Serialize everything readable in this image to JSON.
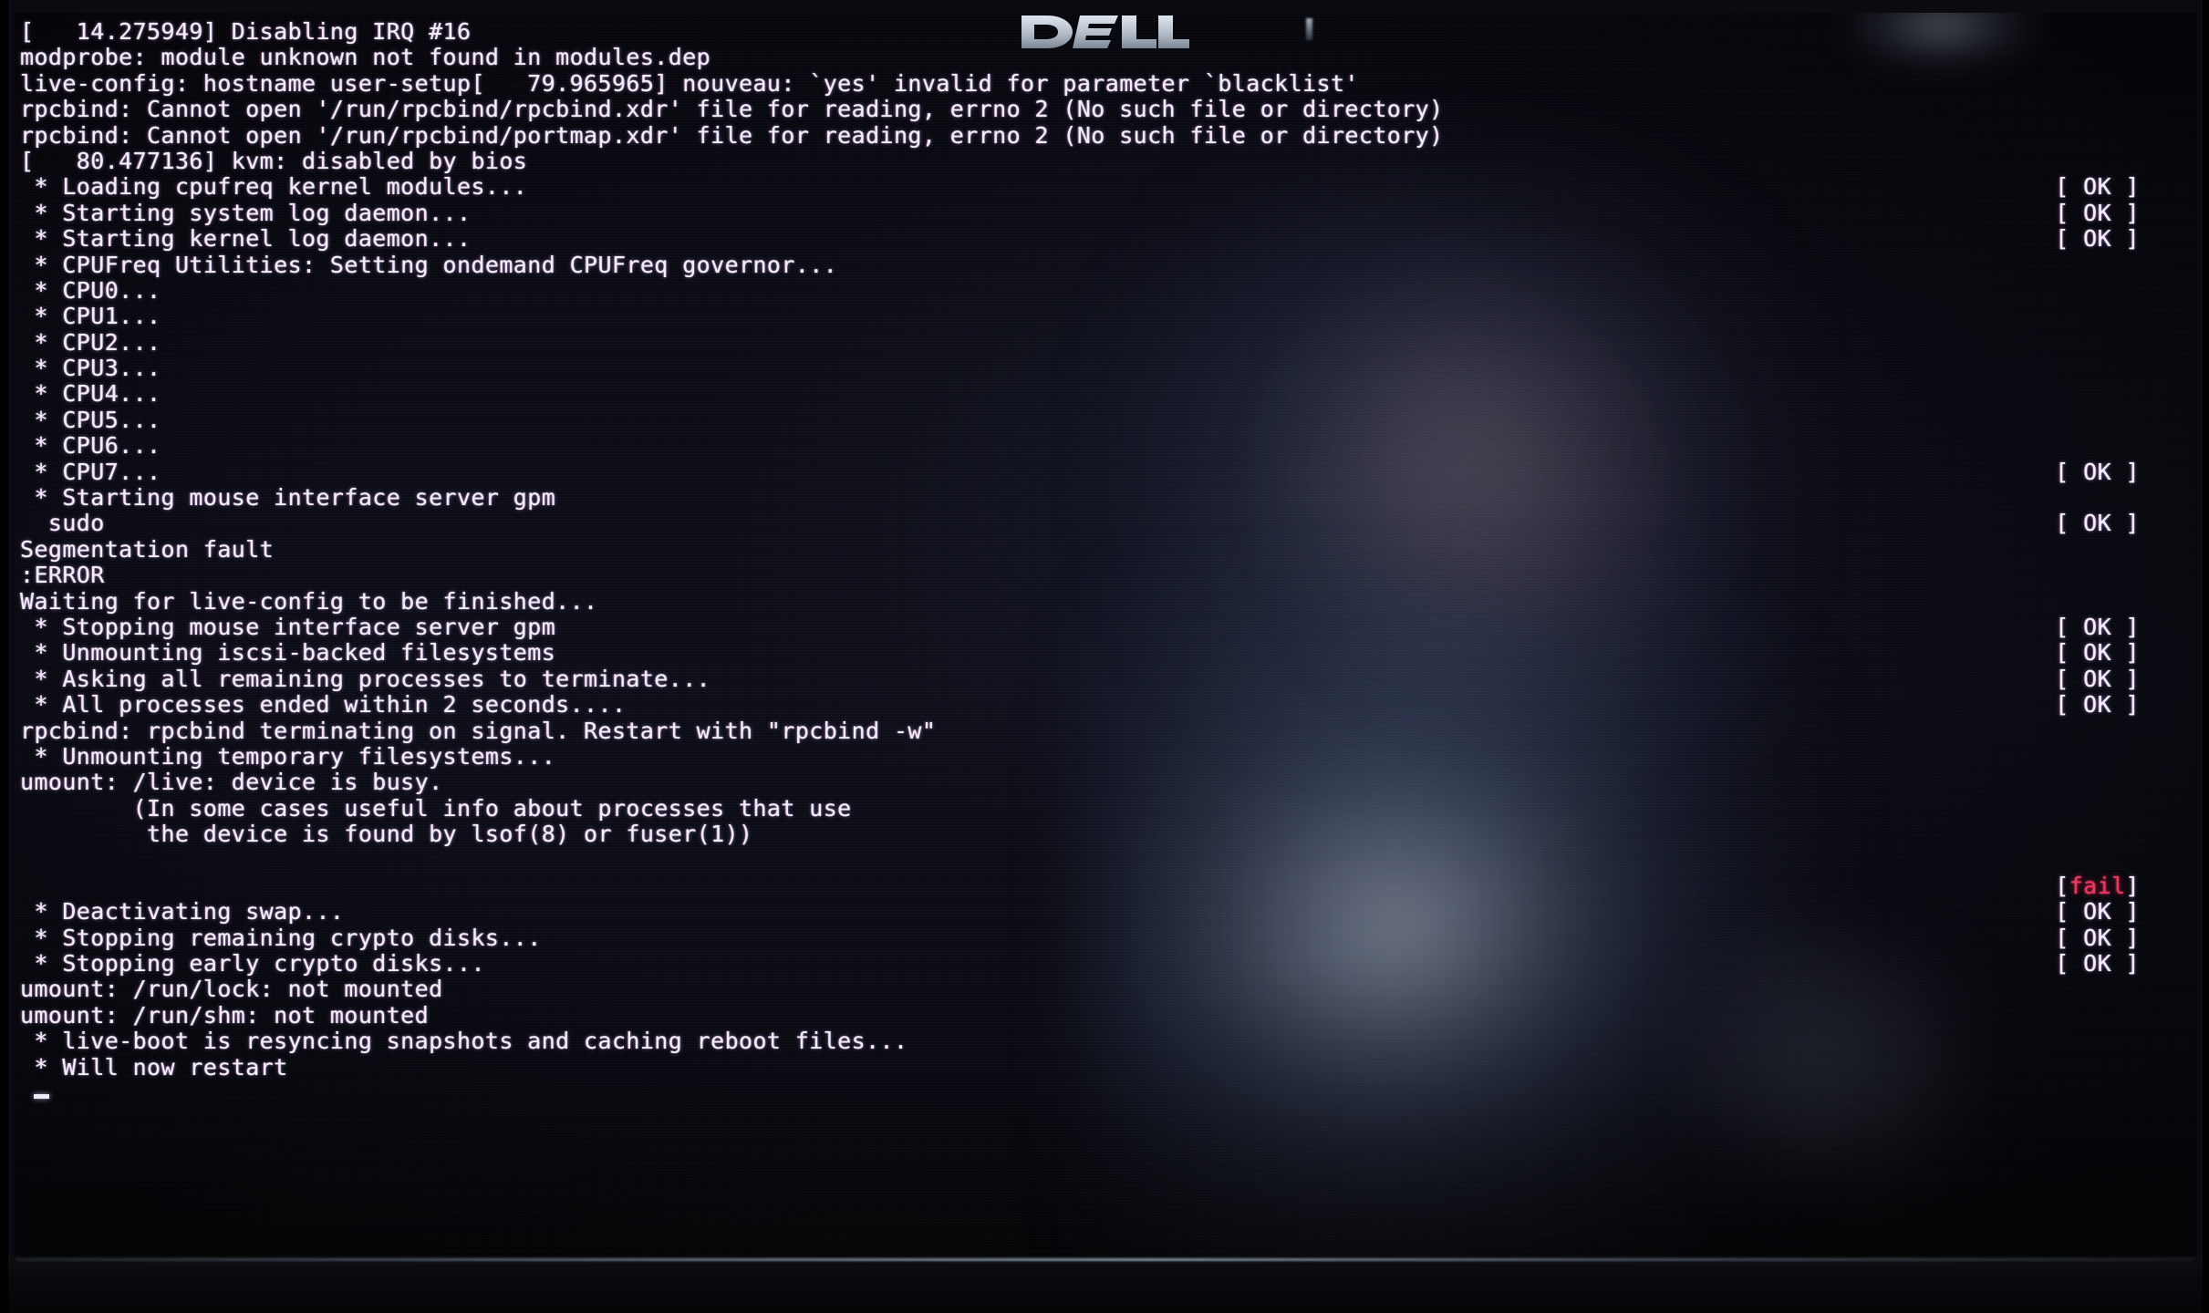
{
  "device": {
    "brand": "DELL",
    "logo_name": "dell-logo",
    "panel_label": "lcd-monitor"
  },
  "console": {
    "fg_color": "#f1eef8",
    "bg_color": "#0a0b14",
    "fail_color": "#f0365e",
    "ok_marker": "[ OK ]",
    "fail_marker_open": "[",
    "fail_marker_word": "fail",
    "fail_marker_close": "]",
    "cursor": "_",
    "lines": [
      {
        "text": "[   14.275949] Disabling IRQ #16",
        "status": ""
      },
      {
        "text": "modprobe: module unknown not found in modules.dep",
        "status": ""
      },
      {
        "text": "live-config: hostname user-setup[   79.965965] nouveau: `yes' invalid for parameter `blacklist'",
        "status": ""
      },
      {
        "text": "rpcbind: Cannot open '/run/rpcbind/rpcbind.xdr' file for reading, errno 2 (No such file or directory)",
        "status": ""
      },
      {
        "text": "rpcbind: Cannot open '/run/rpcbind/portmap.xdr' file for reading, errno 2 (No such file or directory)",
        "status": ""
      },
      {
        "text": "[   80.477136] kvm: disabled by bios",
        "status": ""
      },
      {
        "text": " * Loading cpufreq kernel modules...",
        "status": "ok"
      },
      {
        "text": " * Starting system log daemon...",
        "status": "ok"
      },
      {
        "text": " * Starting kernel log daemon...",
        "status": "ok"
      },
      {
        "text": " * CPUFreq Utilities: Setting ondemand CPUFreq governor...",
        "status": ""
      },
      {
        "text": " * CPU0...",
        "status": ""
      },
      {
        "text": " * CPU1...",
        "status": ""
      },
      {
        "text": " * CPU2...",
        "status": ""
      },
      {
        "text": " * CPU3...",
        "status": ""
      },
      {
        "text": " * CPU4...",
        "status": ""
      },
      {
        "text": " * CPU5...",
        "status": ""
      },
      {
        "text": " * CPU6...",
        "status": ""
      },
      {
        "text": " * CPU7...",
        "status": "ok"
      },
      {
        "text": " * Starting mouse interface server gpm",
        "status": ""
      },
      {
        "text": "  sudo",
        "status": "ok"
      },
      {
        "text": "Segmentation fault",
        "status": ""
      },
      {
        "text": ":ERROR",
        "status": ""
      },
      {
        "text": "Waiting for live-config to be finished...",
        "status": ""
      },
      {
        "text": " * Stopping mouse interface server gpm",
        "status": "ok"
      },
      {
        "text": " * Unmounting iscsi-backed filesystems",
        "status": "ok"
      },
      {
        "text": " * Asking all remaining processes to terminate...",
        "status": "ok"
      },
      {
        "text": " * All processes ended within 2 seconds....",
        "status": "ok"
      },
      {
        "text": "rpcbind: rpcbind terminating on signal. Restart with \"rpcbind -w\"",
        "status": ""
      },
      {
        "text": " * Unmounting temporary filesystems...",
        "status": ""
      },
      {
        "text": "umount: /live: device is busy.",
        "status": ""
      },
      {
        "text": "        (In some cases useful info about processes that use",
        "status": ""
      },
      {
        "text": "         the device is found by lsof(8) or fuser(1))",
        "status": ""
      },
      {
        "text": "",
        "status": ""
      },
      {
        "text": "",
        "status": "fail"
      },
      {
        "text": " * Deactivating swap...",
        "status": "ok"
      },
      {
        "text": " * Stopping remaining crypto disks...",
        "status": "ok"
      },
      {
        "text": " * Stopping early crypto disks...",
        "status": "ok"
      },
      {
        "text": "umount: /run/lock: not mounted",
        "status": ""
      },
      {
        "text": "umount: /run/shm: not mounted",
        "status": ""
      },
      {
        "text": " * live-boot is resyncing snapshots and caching reboot files...",
        "status": ""
      },
      {
        "text": " * Will now restart",
        "status": ""
      }
    ]
  }
}
